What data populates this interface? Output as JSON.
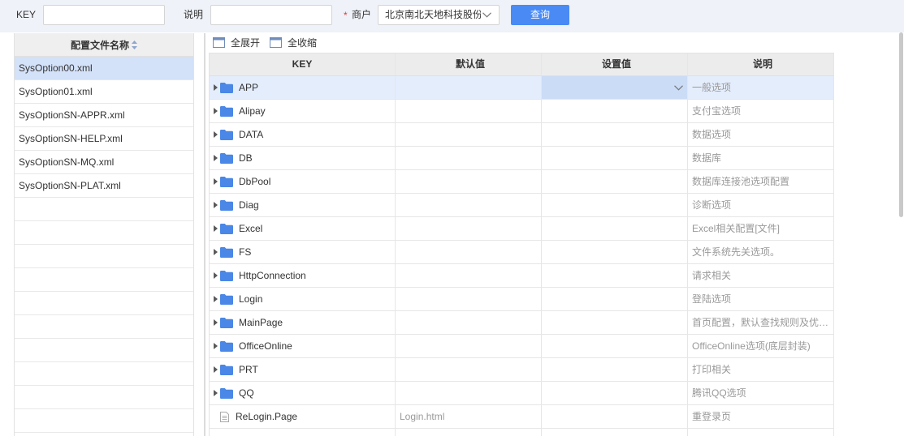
{
  "search": {
    "key_label": "KEY",
    "key_value": "",
    "desc_label": "说明",
    "desc_value": "",
    "required_mark": "*",
    "merchant_label": "商户",
    "merchant_value": "北京南北天地科技股份",
    "merchant_icon": "chevron-down-icon",
    "query_button": "查询"
  },
  "file_panel": {
    "header": "配置文件名称",
    "header_icon": "sort-icon",
    "selected_index": 0,
    "files": [
      "SysOption00.xml",
      "SysOption01.xml",
      "SysOptionSN-APPR.xml",
      "SysOptionSN-HELP.xml",
      "SysOptionSN-MQ.xml",
      "SysOptionSN-PLAT.xml"
    ]
  },
  "toolbar": {
    "expand_all": {
      "label": "全展开",
      "icon": "window-icon"
    },
    "collapse_all": {
      "label": "全收缩",
      "icon": "window-icon"
    }
  },
  "grid": {
    "columns": {
      "key": "KEY",
      "default": "默认值",
      "setting": "设置值",
      "desc": "说明"
    },
    "selected_index": 0,
    "active_editor": {
      "column": "setting",
      "type": "dropdown",
      "icon": "chevron-down-icon"
    },
    "rows": [
      {
        "key": "APP",
        "node": "folder",
        "expanded": false,
        "default": "",
        "setting": "",
        "desc": "一般选项"
      },
      {
        "key": "Alipay",
        "node": "folder",
        "expanded": false,
        "default": "",
        "setting": "",
        "desc": "支付宝选项"
      },
      {
        "key": "DATA",
        "node": "folder",
        "expanded": false,
        "default": "",
        "setting": "",
        "desc": "数据选项"
      },
      {
        "key": "DB",
        "node": "folder",
        "expanded": false,
        "default": "",
        "setting": "",
        "desc": "数据库"
      },
      {
        "key": "DbPool",
        "node": "folder",
        "expanded": false,
        "default": "",
        "setting": "",
        "desc": "数据库连接池选项配置"
      },
      {
        "key": "Diag",
        "node": "folder",
        "expanded": false,
        "default": "",
        "setting": "",
        "desc": "诊断选项"
      },
      {
        "key": "Excel",
        "node": "folder",
        "expanded": false,
        "default": "",
        "setting": "",
        "desc": "Excel相关配置[文件]"
      },
      {
        "key": "FS",
        "node": "folder",
        "expanded": false,
        "default": "",
        "setting": "",
        "desc": "文件系统先关选项。"
      },
      {
        "key": "HttpConnection",
        "node": "folder",
        "expanded": false,
        "default": "",
        "setting": "",
        "desc": "请求相关"
      },
      {
        "key": "Login",
        "node": "folder",
        "expanded": false,
        "default": "",
        "setting": "",
        "desc": "登陆选项"
      },
      {
        "key": "MainPage",
        "node": "folder",
        "expanded": false,
        "default": "",
        "setting": "",
        "desc": "首页配置，默认查找规则及优…"
      },
      {
        "key": "OfficeOnline",
        "node": "folder",
        "expanded": false,
        "default": "",
        "setting": "",
        "desc": "OfficeOnline选项(底层封装)"
      },
      {
        "key": "PRT",
        "node": "folder",
        "expanded": false,
        "default": "",
        "setting": "",
        "desc": "打印相关"
      },
      {
        "key": "QQ",
        "node": "folder",
        "expanded": false,
        "default": "",
        "setting": "",
        "desc": "腾讯QQ选项"
      },
      {
        "key": "ReLogin.Page",
        "node": "file",
        "default": "Login.html",
        "setting": "",
        "desc": "重登录页"
      }
    ]
  },
  "colors": {
    "topbar_bg": "#eff2f8",
    "accent": "#4a8af4",
    "required": "#e4393c",
    "selected_file_bg": "#d3e1f9",
    "selected_row_bg": "#e4edfc",
    "editor_bg": "#cbdcf6",
    "folder": "#4a87e6",
    "muted_text": "#999999"
  }
}
